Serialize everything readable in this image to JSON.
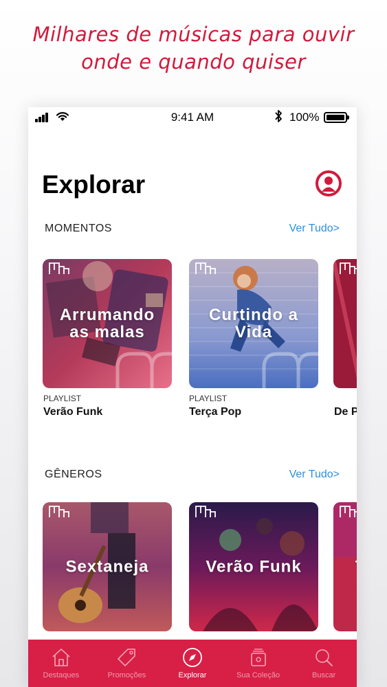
{
  "headline": {
    "line1": "Milhares de músicas para ouvir",
    "line2": "onde e quando quiser"
  },
  "status_bar": {
    "time": "9:41 AM",
    "battery": "100%",
    "battery_level": 1.0
  },
  "page_title": "Explorar",
  "sections": {
    "moments": {
      "label": "MOMENTOS",
      "see_all": "Ver Tudo>",
      "cards": [
        {
          "caption": "Arrumando as malas",
          "type": "PLAYLIST",
          "name": "Verão Funk"
        },
        {
          "caption": "Curtindo a Vida",
          "type": "PLAYLIST",
          "name": "Terça Pop"
        },
        {
          "caption": "",
          "type": "",
          "name": "De P"
        }
      ]
    },
    "genres": {
      "label": "GÊNEROS",
      "see_all": "Ver Tudo>",
      "cards": [
        {
          "caption": "Sextaneja"
        },
        {
          "caption": "Verão Funk"
        },
        {
          "caption": "T"
        }
      ]
    }
  },
  "tabbar": [
    {
      "label": "Destaques",
      "icon": "home-icon",
      "active": false
    },
    {
      "label": "Promoções",
      "icon": "tag-icon",
      "active": false
    },
    {
      "label": "Explorar",
      "icon": "compass-icon",
      "active": true
    },
    {
      "label": "Sua Coleção",
      "icon": "collection-icon",
      "active": false
    },
    {
      "label": "Buscar",
      "icon": "search-icon",
      "active": false
    }
  ],
  "colors": {
    "brand": "#d81f46",
    "link": "#2f8fd8"
  }
}
